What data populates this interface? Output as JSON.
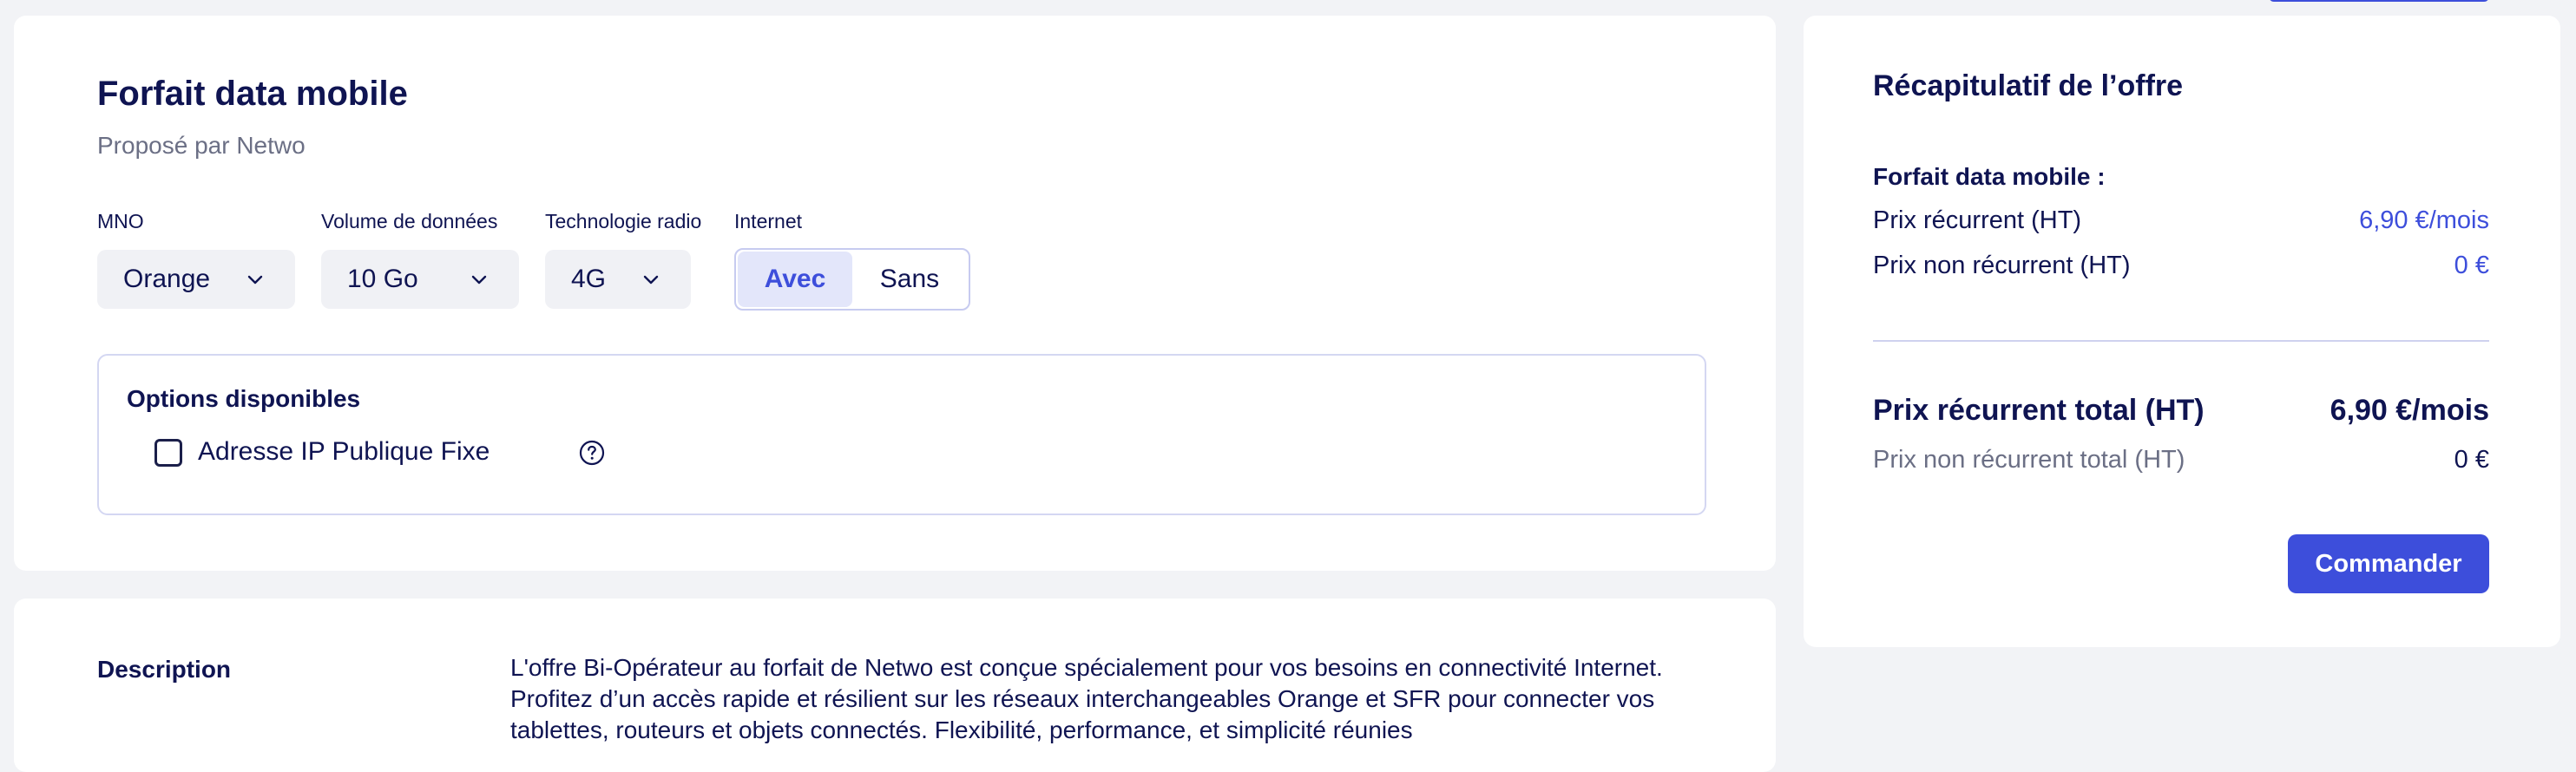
{
  "product": {
    "title": "Forfait data mobile",
    "subtitle": "Proposé par Netwo",
    "filters": {
      "mno_label": "MNO",
      "mno_value": "Orange",
      "volume_label": "Volume de données",
      "volume_value": "10 Go",
      "tech_label": "Technologie radio",
      "tech_value": "4G",
      "internet_label": "Internet",
      "internet_options": [
        "Avec",
        "Sans"
      ],
      "internet_selected": "Avec"
    },
    "options": {
      "title": "Options disponibles",
      "items": [
        {
          "label": "Adresse IP Publique Fixe",
          "checked": false,
          "icon": "help-circle-icon"
        }
      ]
    }
  },
  "description": {
    "label": "Description",
    "text": "L'offre Bi-Opérateur au forfait de Netwo est conçue spécialement pour vos besoins en connectivité Internet. Profitez d’un accès rapide et résilient sur les réseaux interchangeables Orange et SFR pour connecter vos tablettes, routeurs et objets connectés. Flexibilité, performance, et simplicité réunies"
  },
  "summary": {
    "title": "Récapitulatif de l’offre",
    "heading": "Forfait data mobile :",
    "recurring_label": "Prix récurrent (HT)",
    "recurring_value": "6,90 €/mois",
    "nonrecurring_label": "Prix non récurrent (HT)",
    "nonrecurring_value": "0 €",
    "total_recurring_label": "Prix récurrent total (HT)",
    "total_recurring_value": "6,90 €/mois",
    "total_nonrecurring_label": "Prix non récurrent total (HT)",
    "total_nonrecurring_value": "0 €",
    "order_button": "Commander"
  },
  "colors": {
    "accent": "#3d4edb",
    "text": "#0f1452",
    "muted": "#6b6f85",
    "background": "#f2f3f6"
  }
}
